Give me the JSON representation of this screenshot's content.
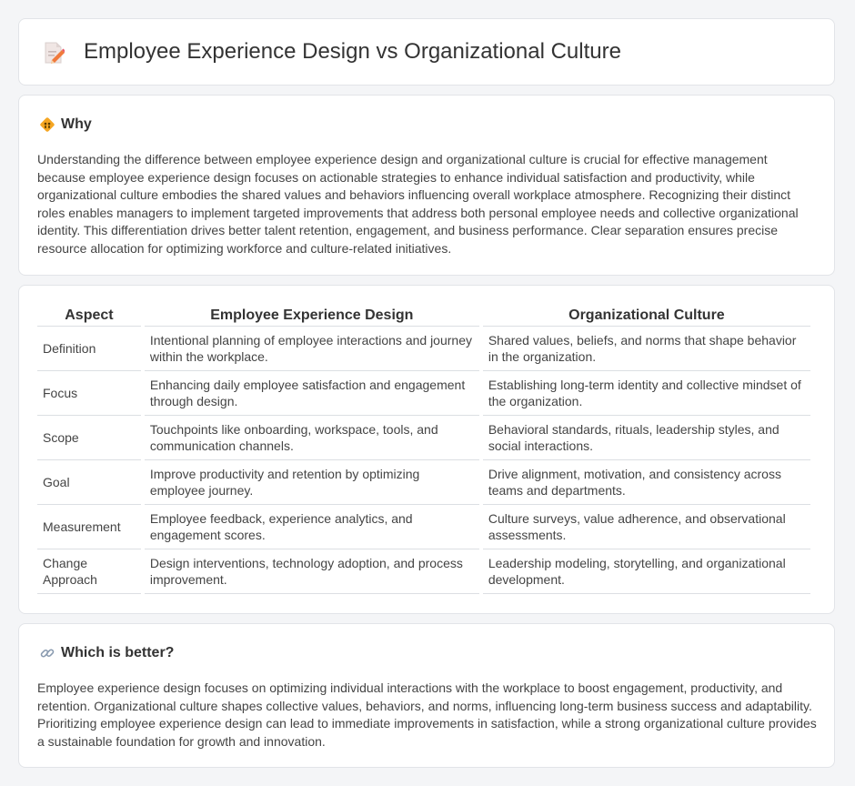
{
  "header": {
    "title": "Employee Experience Design vs Organizational Culture",
    "icon": "document-pencil-icon"
  },
  "why": {
    "icon": "diamond-sign-icon",
    "heading": "Why",
    "text": "Understanding the difference between employee experience design and organizational culture is crucial for effective management because employee experience design focuses on actionable strategies to enhance individual satisfaction and productivity, while organizational culture embodies the shared values and behaviors influencing overall workplace atmosphere. Recognizing their distinct roles enables managers to implement targeted improvements that address both personal employee needs and collective organizational identity. This differentiation drives better talent retention, engagement, and business performance. Clear separation ensures precise resource allocation for optimizing workforce and culture-related initiatives."
  },
  "comparison": {
    "headers": [
      "Aspect",
      "Employee Experience Design",
      "Organizational Culture"
    ],
    "rows": [
      [
        "Definition",
        "Intentional planning of employee interactions and journey within the workplace.",
        "Shared values, beliefs, and norms that shape behavior in the organization."
      ],
      [
        "Focus",
        "Enhancing daily employee satisfaction and engagement through design.",
        "Establishing long-term identity and collective mindset of the organization."
      ],
      [
        "Scope",
        "Touchpoints like onboarding, workspace, tools, and communication channels.",
        "Behavioral standards, rituals, leadership styles, and social interactions."
      ],
      [
        "Goal",
        "Improve productivity and retention by optimizing employee journey.",
        "Drive alignment, motivation, and consistency across teams and departments."
      ],
      [
        "Measurement",
        "Employee feedback, experience analytics, and engagement scores.",
        "Culture surveys, value adherence, and observational assessments."
      ],
      [
        "Change Approach",
        "Design interventions, technology adoption, and process improvement.",
        "Leadership modeling, storytelling, and organizational development."
      ]
    ]
  },
  "better": {
    "icon": "link-icon",
    "heading": "Which is better?",
    "text": "Employee experience design focuses on optimizing individual interactions with the workplace to boost engagement, productivity, and retention. Organizational culture shapes collective values, behaviors, and norms, influencing long-term business success and adaptability. Prioritizing employee experience design can lead to immediate improvements in satisfaction, while a strong organizational culture provides a sustainable foundation for growth and innovation."
  }
}
